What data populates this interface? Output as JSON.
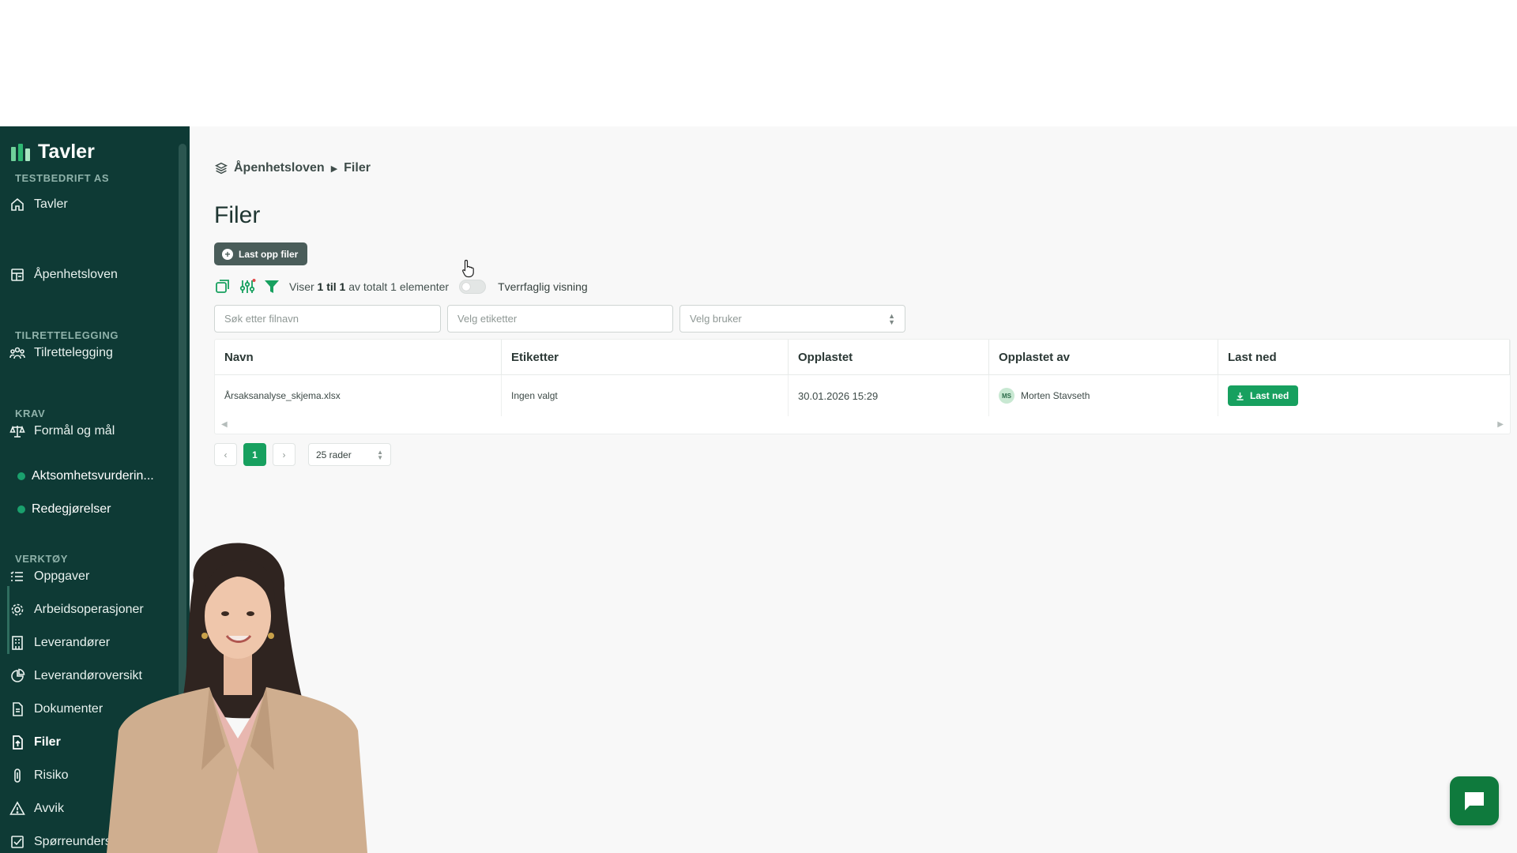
{
  "app": {
    "name": "Tavler",
    "accent": "#17a05f",
    "sidebar_bg": "#0e3a35"
  },
  "sidebar": {
    "company": "TESTBEDRIFT AS",
    "home": "Tavler",
    "openness": "Åpenhetsloven",
    "section_adapt": "TILRETTELEGGING",
    "adapt": "Tilrettelegging",
    "section_req": "KRAV",
    "purpose": "Formål og mål",
    "sub_items": [
      "Aktsomhetsvurderin...",
      "Redegjørelser"
    ],
    "section_tools": "VERKTØY",
    "tools": [
      "Oppgaver",
      "Arbeidsoperasjoner",
      "Leverandører",
      "Leverandøroversikt",
      "Dokumenter",
      "Filer",
      "Risiko",
      "Avvik",
      "Spørreundersøkelser"
    ]
  },
  "breadcrumb": {
    "root": "Åpenhetsloven",
    "current": "Filer"
  },
  "page": {
    "title": "Filer",
    "upload_label": "Last opp filer"
  },
  "toolbar": {
    "showing_prefix": "Viser",
    "showing_range": "1 til 1",
    "showing_suffix": "av totalt 1 elementer",
    "toggle_label": "Tverrfaglig visning",
    "toggle_on": false
  },
  "filters": {
    "search_placeholder": "Søk etter filnavn",
    "tags_placeholder": "Velg etiketter",
    "user_placeholder": "Velg bruker"
  },
  "table": {
    "headers": [
      "Navn",
      "Etiketter",
      "Opplastet",
      "Opplastet av",
      "Last ned"
    ],
    "rows": [
      {
        "name": "Årsaksanalyse_skjema.xlsx",
        "tags": "Ingen valgt",
        "uploaded": "30.01.2026 15:29",
        "initials": "MS",
        "uploaded_by": "Morten Stavseth",
        "download_label": "Last ned"
      }
    ]
  },
  "pagination": {
    "current_page": "1",
    "rows_label": "25 rader"
  }
}
